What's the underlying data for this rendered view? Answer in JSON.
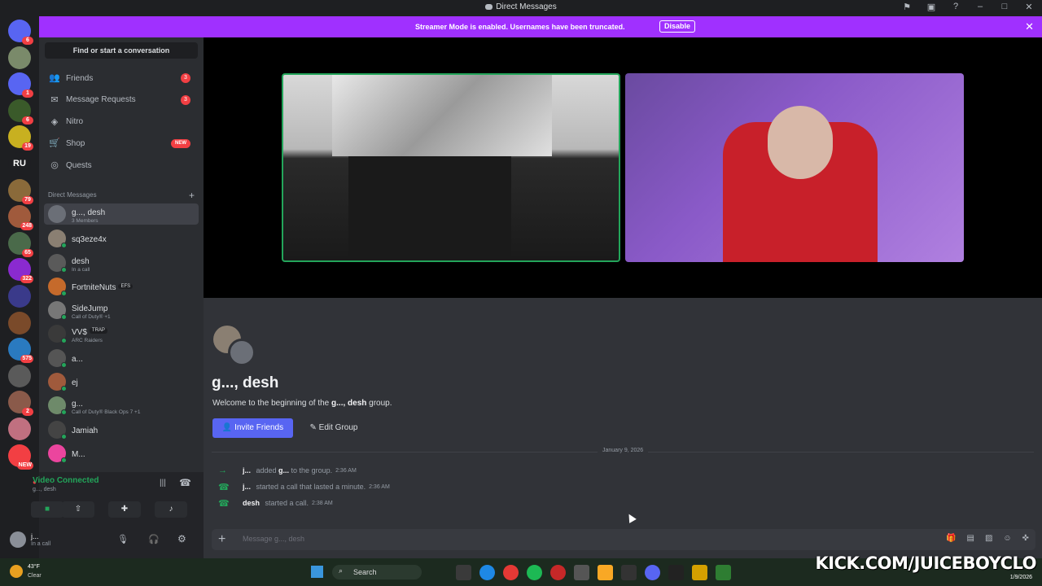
{
  "window": {
    "title": "Direct Messages"
  },
  "streamer_bar": {
    "message": "Streamer Mode is enabled. Usernames have been truncated.",
    "disable_label": "Disable"
  },
  "servers": [
    {
      "badge": "6"
    },
    {
      "badge": ""
    },
    {
      "badge": "1"
    },
    {
      "badge": "6"
    },
    {
      "badge": "19"
    },
    {
      "label": "RU",
      "badge": ""
    },
    {
      "badge": "79"
    },
    {
      "badge": "248"
    },
    {
      "badge": "65"
    },
    {
      "badge": "322"
    },
    {
      "badge": ""
    },
    {
      "badge": ""
    },
    {
      "badge": "575"
    },
    {
      "badge": ""
    },
    {
      "badge": "2"
    },
    {
      "badge": ""
    },
    {
      "badge": "NEW"
    }
  ],
  "sidebar": {
    "search": "Find or start a conversation",
    "nav": [
      {
        "label": "Friends",
        "count": "3"
      },
      {
        "label": "Message Requests",
        "count": "3"
      },
      {
        "label": "Nitro",
        "count": ""
      },
      {
        "label": "Shop",
        "count": "NEW"
      },
      {
        "label": "Quests",
        "count": ""
      }
    ],
    "dm_header": "Direct Messages",
    "dms": [
      {
        "name": "g..., desh",
        "sub": "3 Members",
        "color": "#6b6f77"
      },
      {
        "name": "sq3eze4x",
        "sub": "",
        "color": "#8a7f72"
      },
      {
        "name": "desh",
        "sub": "In a call",
        "color": "#5a5a5a"
      },
      {
        "name": "FortniteNuts",
        "sub": "",
        "tag": "EFS",
        "color": "#c56a2b"
      },
      {
        "name": "SideJump",
        "sub": "Call of Duty® +1",
        "color": "#777"
      },
      {
        "name": "VV$",
        "sub": "ARC Raiders",
        "tag": "TRAP",
        "color": "#3a3a3a"
      },
      {
        "name": "a...",
        "sub": "",
        "color": "#555"
      },
      {
        "name": "ej",
        "sub": "",
        "color": "#a05a3c"
      },
      {
        "name": "g...",
        "sub": "Call of Duty® Black Ops 7 +1",
        "color": "#6e8a6a"
      },
      {
        "name": "Jamiah",
        "sub": "",
        "color": "#444"
      },
      {
        "name": "M...",
        "sub": "",
        "color": "#eb459e"
      }
    ]
  },
  "voice": {
    "status": "Video Connected",
    "channel": "g..., desh"
  },
  "user": {
    "name": "j...",
    "status": "In a call"
  },
  "chat": {
    "title": "g..., desh",
    "welcome_prefix": "Welcome to the beginning of the ",
    "welcome_name": "g..., desh",
    "welcome_suffix": " group.",
    "invite_label": "Invite Friends",
    "edit_label": "Edit Group",
    "date_divider": "January 9, 2026",
    "messages": [
      {
        "actor": "j...",
        "text_before": " added ",
        "target": "g...",
        "text_after": " to the group.",
        "time": "2:36 AM"
      },
      {
        "actor": "j...",
        "text_before": " started a call that lasted a minute.",
        "target": "",
        "text_after": "",
        "time": "2:36 AM"
      },
      {
        "actor": "desh",
        "text_before": " started a call.",
        "target": "",
        "text_after": "",
        "time": "2:38 AM"
      }
    ],
    "composer_placeholder": "Message g..., desh"
  },
  "taskbar": {
    "weather_temp": "43°F",
    "weather_desc": "Clear",
    "search": "Search",
    "date": "1/9/2026"
  },
  "overlay": {
    "watermark": "KICK.COM/JUICEBOYCLO"
  }
}
